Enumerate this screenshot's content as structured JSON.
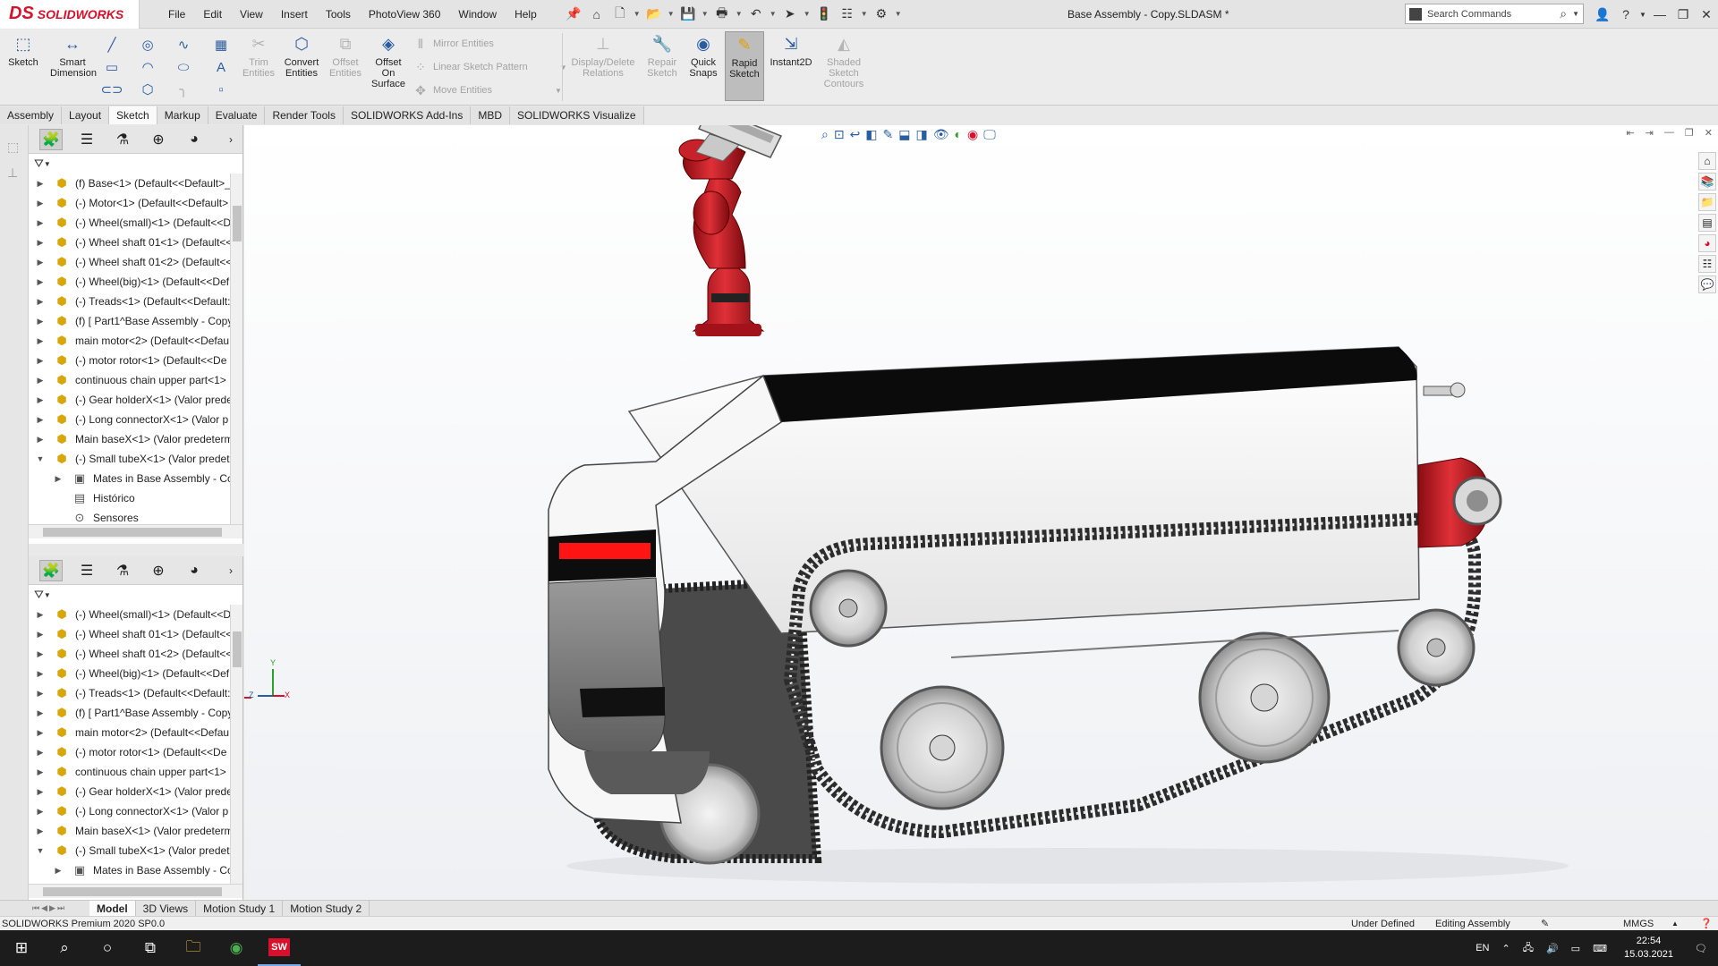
{
  "app": {
    "name": "SOLIDWORKS",
    "logo_mark": "DS"
  },
  "menu": [
    "File",
    "Edit",
    "View",
    "Insert",
    "Tools",
    "PhotoView 360",
    "Window",
    "Help"
  ],
  "document_title": "Base Assembly - Copy.SLDASM *",
  "search": {
    "placeholder": "Search Commands"
  },
  "command_manager": {
    "sketch": "Sketch",
    "smart_dimension": [
      "Smart",
      "Dimension"
    ],
    "trim": [
      "Trim",
      "Entities"
    ],
    "convert": [
      "Convert",
      "Entities"
    ],
    "offset": [
      "Offset",
      "Entities"
    ],
    "offset_surface": [
      "Offset",
      "On",
      "Surface"
    ],
    "mirror": "Mirror Entities",
    "linear_pattern": "Linear Sketch Pattern",
    "move": "Move Entities",
    "display_delete": [
      "Display/Delete",
      "Relations"
    ],
    "repair": [
      "Repair",
      "Sketch"
    ],
    "quick_snaps": [
      "Quick",
      "Snaps"
    ],
    "rapid_sketch": [
      "Rapid",
      "Sketch"
    ],
    "instant2d": "Instant2D",
    "shaded_contours": [
      "Shaded",
      "Sketch",
      "Contours"
    ]
  },
  "tabs": [
    "Assembly",
    "Layout",
    "Sketch",
    "Markup",
    "Evaluate",
    "Render Tools",
    "SOLIDWORKS Add-Ins",
    "MBD",
    "SOLIDWORKS Visualize"
  ],
  "active_tab": "Sketch",
  "tree_top": [
    "(f) Base<1> (Default<<Default>_",
    "(-) Motor<1> (Default<<Default>",
    "(-) Wheel(small)<1> (Default<<D",
    "(-) Wheel shaft 01<1> (Default<<",
    "(-) Wheel shaft 01<2> (Default<<",
    "(-) Wheel(big)<1> (Default<<Def",
    "(-) Treads<1> (Default<<Default:",
    "(f) [ Part1^Base Assembly - Copy",
    "main motor<2> (Default<<Defau",
    "(-) motor rotor<1> (Default<<De",
    "continuous chain upper part<1>",
    "(-) Gear holderX<1> (Valor prede",
    "(-) Long connectorX<1> (Valor p",
    "Main baseX<1> (Valor predeterm",
    "(-) Small tubeX<1> (Valor predet"
  ],
  "tree_top_sub": [
    "Mates in Base Assembly - Co",
    "Histórico",
    "Sensores"
  ],
  "tree_bottom": [
    "(-) Wheel(small)<1> (Default<<D",
    "(-) Wheel shaft 01<1> (Default<<",
    "(-) Wheel shaft 01<2> (Default<<",
    "(-) Wheel(big)<1> (Default<<Def",
    "(-) Treads<1> (Default<<Default:",
    "(f) [ Part1^Base Assembly - Copy",
    "main motor<2> (Default<<Defau",
    "(-) motor rotor<1> (Default<<De",
    "continuous chain upper part<1>",
    "(-) Gear holderX<1> (Valor prede",
    "(-) Long connectorX<1> (Valor p",
    "Main baseX<1> (Valor predeterm",
    "(-) Small tubeX<1> (Valor predet"
  ],
  "tree_bottom_sub": [
    "Mates in Base Assembly - Co"
  ],
  "bottom_tabs": [
    "Model",
    "3D Views",
    "Motion Study 1",
    "Motion Study 2"
  ],
  "active_bottom_tab": "Model",
  "status": {
    "product": "SOLIDWORKS Premium 2020 SP0.0",
    "state": "Under Defined",
    "mode": "Editing Assembly",
    "units": "MMGS"
  },
  "taskbar": {
    "lang": "EN",
    "time": "22:54",
    "date": "15.03.2021",
    "app_badge": "SW"
  },
  "triad": {
    "y": "Y",
    "z": "Z",
    "x": "X"
  },
  "colors": {
    "brand_red": "#d8102b",
    "accent_blue": "#2a5d9f",
    "cannon_red": "#c8161d"
  }
}
